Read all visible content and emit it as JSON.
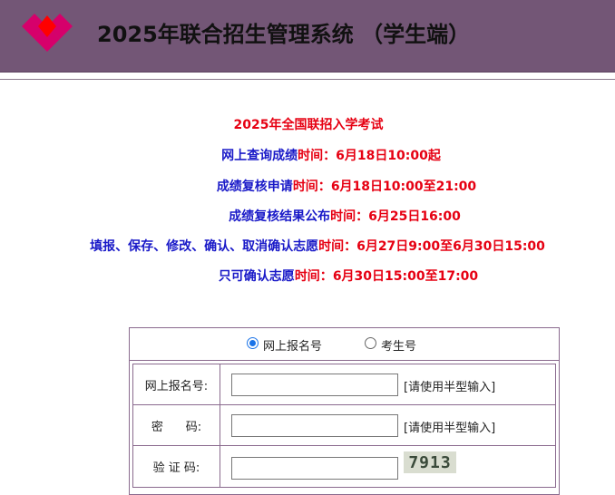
{
  "header": {
    "title": "2025年联合招生管理系统 （学生端）",
    "brand_colors": [
      "#d6006b",
      "#ff0000"
    ]
  },
  "notices": {
    "title": "2025年全国联招入学考试",
    "items": [
      {
        "label": "网上查询成绩",
        "time_prefix": "时间：",
        "time": "6月18日10:00起"
      },
      {
        "label": "成绩复核申请",
        "time_prefix": "时间：",
        "time": "6月18日10:00至21:00"
      },
      {
        "label": "成绩复核结果公布",
        "time_prefix": "时间：",
        "time": "6月25日16:00"
      },
      {
        "label": "填报、保存、修改、确认、取消确认志愿",
        "time_prefix": "时间：",
        "time": "6月27日9:00至6月30日15:00"
      },
      {
        "label": "只可确认志愿",
        "time_prefix": "时间：",
        "time": "6月30日15:00至17:00"
      }
    ]
  },
  "login": {
    "options": [
      {
        "label": "网上报名号",
        "checked": true
      },
      {
        "label": "考生号",
        "checked": false
      }
    ],
    "fields": [
      {
        "label": "网上报名号:",
        "value": "",
        "hint": "[请使用半型输入]"
      },
      {
        "label": "密      码:",
        "value": "",
        "hint": "[请使用半型输入]"
      },
      {
        "label": "验 证 码:",
        "value": "",
        "captcha": "7913"
      }
    ]
  }
}
